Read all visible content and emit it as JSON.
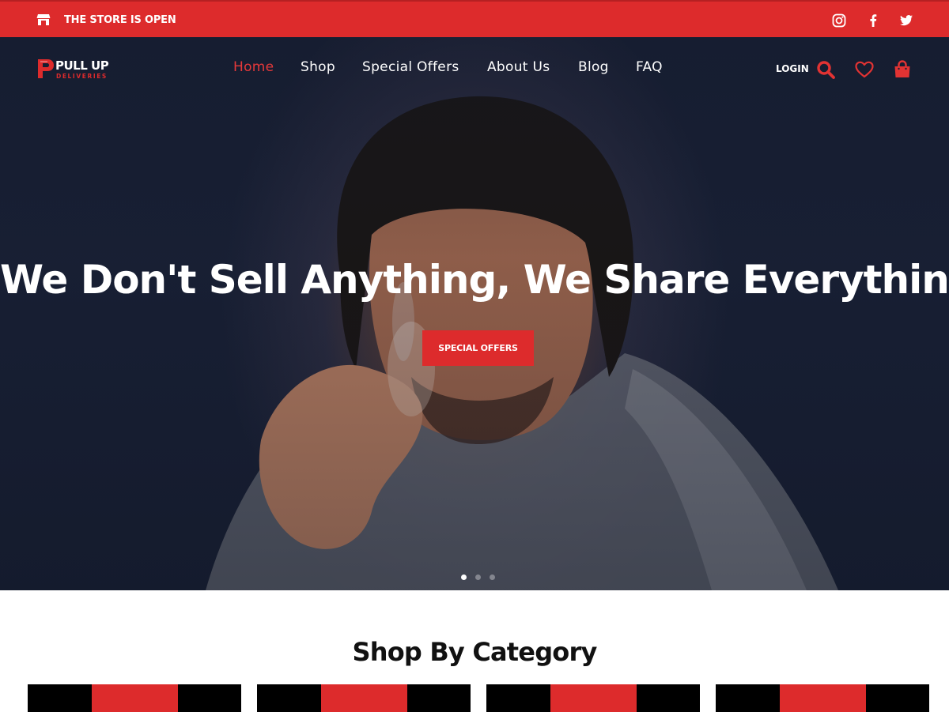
{
  "topbar": {
    "store_status": "The store is open",
    "store_icon": "store-icon",
    "socials": [
      "instagram-icon",
      "facebook-icon",
      "twitter-icon"
    ]
  },
  "brand": {
    "logo_text": "PULL UP",
    "logo_subtext": "DELIVERIES",
    "accent_color": "#dd2b2c"
  },
  "nav": {
    "items": [
      "Home",
      "Shop",
      "Special Offers",
      "About Us",
      "Blog",
      "FAQ"
    ],
    "active": "Home"
  },
  "header_actions": {
    "login_label": "Login",
    "icons": [
      "search-icon",
      "heart-icon",
      "shopping-bag-icon"
    ]
  },
  "hero": {
    "title": "We Don't Sell Anything, We Share Everything.",
    "cta_label": "Special Offers",
    "slide_count": 3,
    "active_slide": 1
  },
  "categories": {
    "title": "Shop By Category",
    "card_count": 4
  }
}
